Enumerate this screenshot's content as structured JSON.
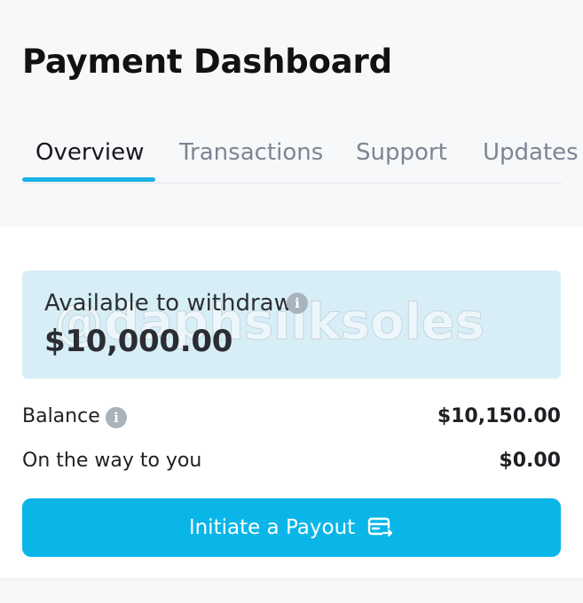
{
  "header": {
    "title": "Payment Dashboard"
  },
  "tabs": [
    {
      "label": "Overview",
      "active": true
    },
    {
      "label": "Transactions",
      "active": false
    },
    {
      "label": "Support",
      "active": false
    },
    {
      "label": "Updates",
      "active": false
    }
  ],
  "withdraw": {
    "label": "Available to withdraw",
    "amount": "$10,000.00",
    "info_icon": "info-icon"
  },
  "watermark": "@daphsilksoles",
  "summary": {
    "balance_label": "Balance",
    "balance_value": "$10,150.00",
    "balance_info_icon": "info-icon",
    "on_the_way_label": "On the way to you",
    "on_the_way_value": "$0.00"
  },
  "payout": {
    "label": "Initiate a Payout",
    "icon": "card-transfer-icon"
  },
  "colors": {
    "accent": "#0ab6e8",
    "tab_indicator": "#19b3e6",
    "withdraw_bg": "#d7eef7",
    "page_bg": "#f7f8fa"
  }
}
